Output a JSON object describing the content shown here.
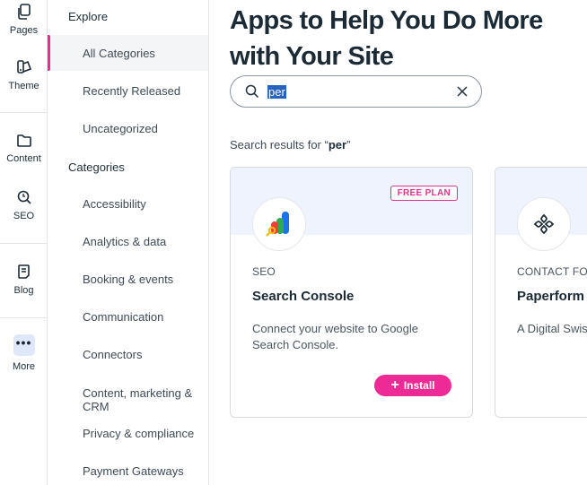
{
  "rail": {
    "pages": "Pages",
    "theme": "Theme",
    "content": "Content",
    "seo": "SEO",
    "blog": "Blog",
    "more": "More"
  },
  "sidebar": {
    "explore_heading": "Explore",
    "explore_items": [
      "All Categories",
      "Recently Released",
      "Uncategorized"
    ],
    "categories_heading": "Categories",
    "category_items": [
      "Accessibility",
      "Analytics & data",
      "Booking & events",
      "Communication",
      "Connectors",
      "Content, marketing & CRM",
      "Privacy & compliance",
      "Payment Gateways"
    ],
    "active_item": "All Categories"
  },
  "main": {
    "title": "Apps to Help You Do More with Your Site",
    "search": {
      "value": "per",
      "placeholder": ""
    },
    "results_prefix": "Search results for “",
    "results_query": "per",
    "results_suffix": "”"
  },
  "cards": [
    {
      "badge": "FREE PLAN",
      "category": "SEO",
      "name": "Search Console",
      "description": "Connect your website to Google Search Console.",
      "install_label": "Install",
      "icon": "google-search-console-logo"
    },
    {
      "category": "CONTACT FORMS",
      "name": "Paperform",
      "description": "A Digital Swiss Army Knife",
      "icon": "paperform-logo"
    }
  ],
  "colors": {
    "accent": "#ee2a96",
    "active_indicator": "#ef2a8f",
    "card_band": "#eef3fd",
    "more_bg": "#dfe7fb",
    "selection": "#2463c4"
  }
}
